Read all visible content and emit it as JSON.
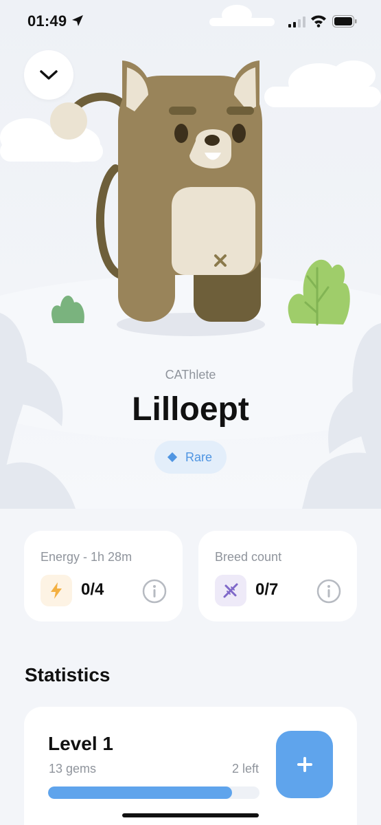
{
  "status_bar": {
    "time": "01:49",
    "icons": [
      "location-arrow-icon",
      "cellular-signal-icon",
      "wifi-icon",
      "battery-icon"
    ]
  },
  "header": {
    "collapse_icon": "chevron-down-icon"
  },
  "pet": {
    "species": "CAThlete",
    "name": "Lilloept",
    "rarity": "Rare",
    "rarity_icon": "diamond-icon",
    "colors": {
      "body": "#99845a",
      "dark": "#6e5f3a",
      "belly": "#ebe3d2"
    }
  },
  "stats": {
    "energy": {
      "title": "Energy - 1h 28m",
      "value": "0/4",
      "icon": "lightning-icon",
      "icon_bg": "#fdf3e4",
      "icon_color": "#f3b042"
    },
    "breed": {
      "title": "Breed count",
      "value": "0/7",
      "icon": "dna-icon",
      "icon_bg": "#eeeaf8",
      "icon_color": "#7f68c9"
    },
    "info_icon": "info-icon"
  },
  "statistics": {
    "section_title": "Statistics",
    "level": {
      "title": "Level 1",
      "gems": "13 gems",
      "left": "2 left",
      "progress": 0.87,
      "add_icon": "plus-icon"
    }
  },
  "colors": {
    "accent": "#5fa4ec",
    "muted_text": "#8f949c",
    "background": "#f3f5f9"
  }
}
